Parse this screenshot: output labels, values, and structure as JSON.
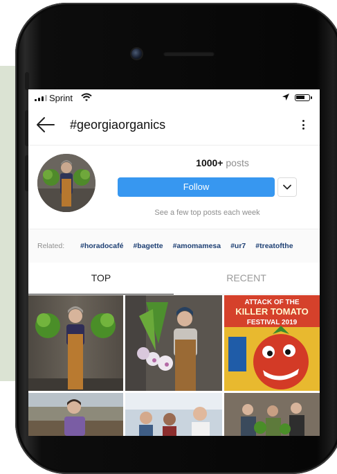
{
  "status_bar": {
    "carrier": "Sprint"
  },
  "nav": {
    "title": "#georgiaorganics"
  },
  "header": {
    "post_count": "1000+",
    "post_label": "posts",
    "follow_label": "Follow",
    "subtext": "See a few top posts each week"
  },
  "related": {
    "label": "Related:",
    "tags": [
      "#horadocafé",
      "#bagette",
      "#amomamesa",
      "#ur7",
      "#treatofthe"
    ]
  },
  "tabs": [
    {
      "label": "TOP",
      "active": true
    },
    {
      "label": "RECENT",
      "active": false
    }
  ],
  "posts": [
    {
      "description": "woman in overalls holding lettuce heads"
    },
    {
      "description": "woman in beanie holding turnips"
    },
    {
      "title_line1": "ATTACK OF THE",
      "title_line2": "KILLER TOMATO",
      "title_line3": "FESTIVAL 2019"
    },
    {
      "description": "woman on farm field"
    },
    {
      "description": "people at a market"
    },
    {
      "description": "group of farmers outdoors"
    }
  ],
  "colors": {
    "follow": "#3797f0",
    "hashtag": "#1d3f73",
    "muted": "#8e8e8e"
  }
}
